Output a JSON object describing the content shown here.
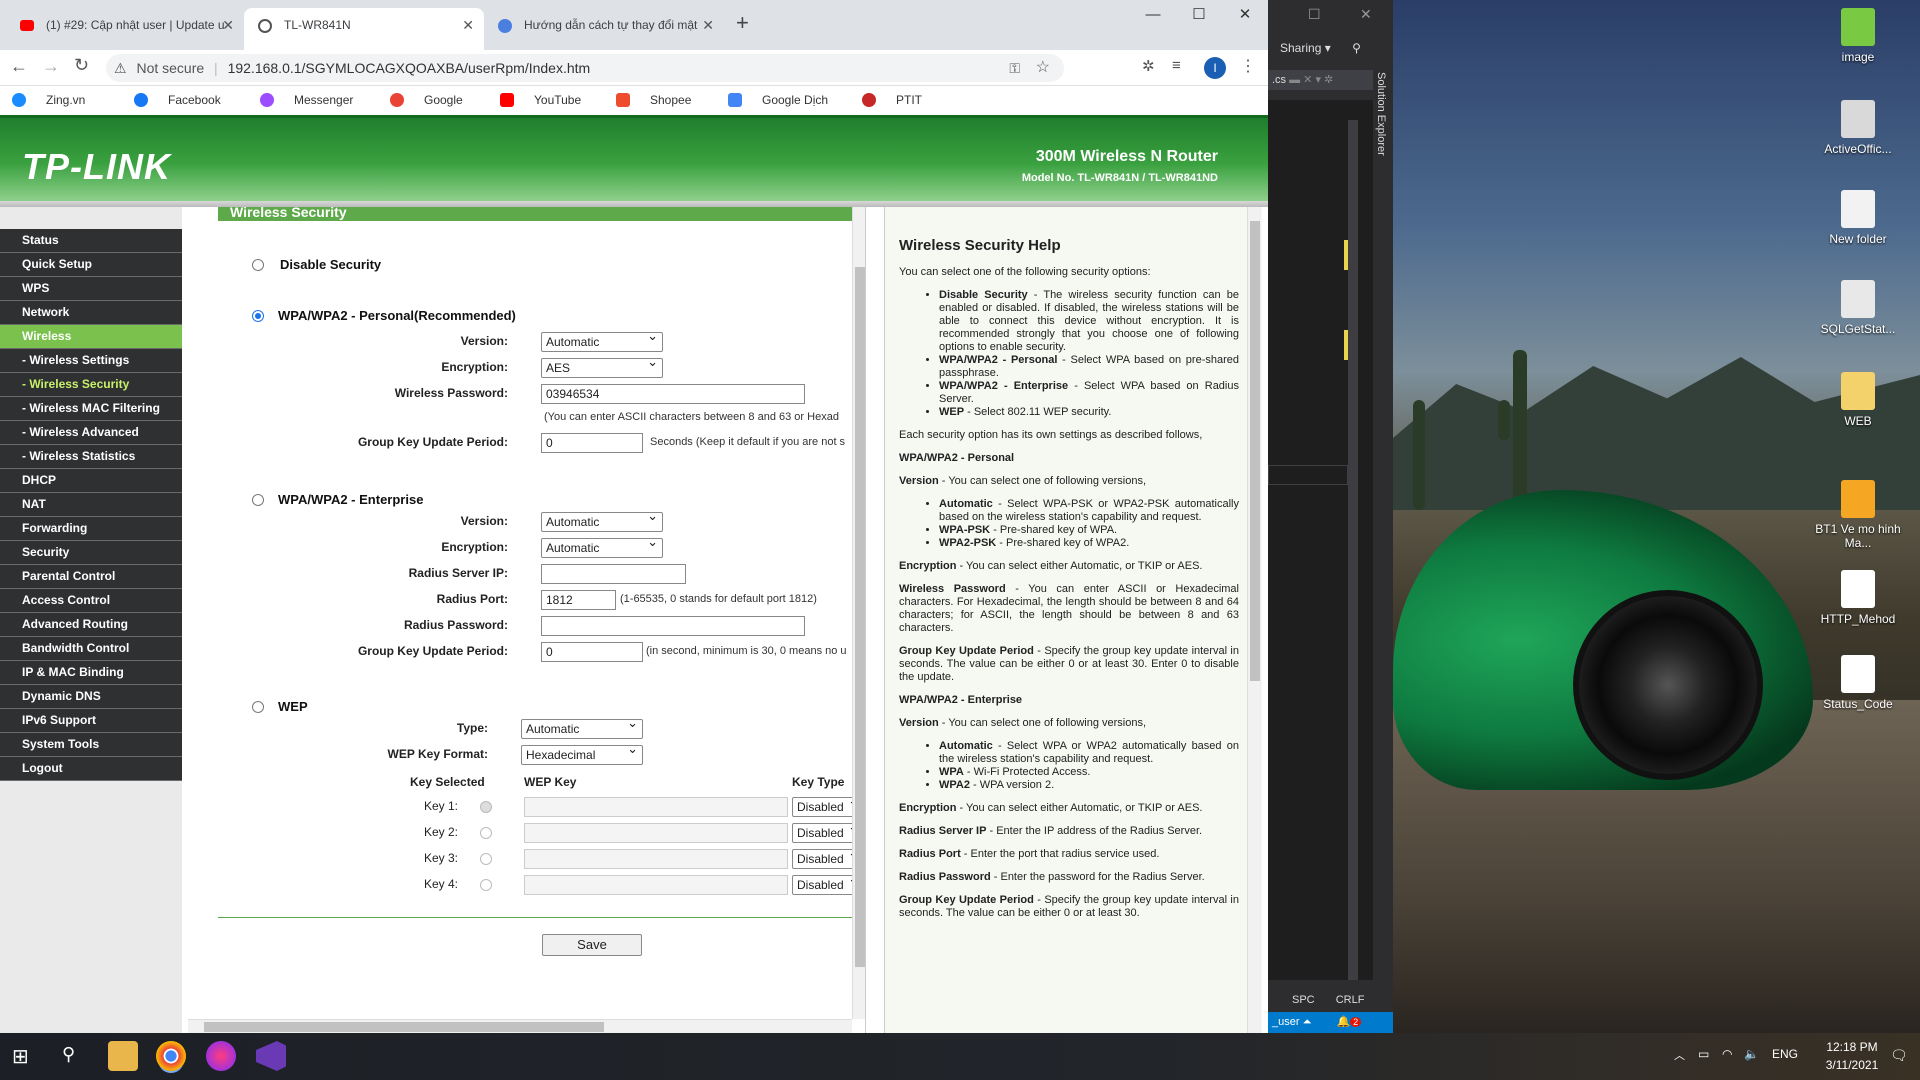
{
  "browser": {
    "tabs": [
      {
        "label": "(1) #29: Cập nhật user | Update u",
        "active": false
      },
      {
        "label": "TL-WR841N",
        "active": true
      },
      {
        "label": "Hướng dẫn cách tự thay đổi mật",
        "active": false
      }
    ],
    "new_tab": "+",
    "window_controls": {
      "minimize": "—",
      "maximize": "☐",
      "close": "✕"
    },
    "security_label": "Not secure",
    "url": "192.168.0.1/SGYMLOCAGXQOAXBA/userRpm/Index.htm",
    "profile_initial": "I",
    "bookmarks": [
      "Zing.vn",
      "Facebook",
      "Messenger",
      "Google",
      "YouTube",
      "Shopee",
      "Google Dịch",
      "PTIT"
    ]
  },
  "router": {
    "logo": "TP-LINK",
    "product": "300M Wireless N Router",
    "model": "Model No. TL-WR841N / TL-WR841ND",
    "menu": [
      {
        "label": "Status",
        "state": ""
      },
      {
        "label": "Quick Setup",
        "state": ""
      },
      {
        "label": "WPS",
        "state": ""
      },
      {
        "label": "Network",
        "state": ""
      },
      {
        "label": "Wireless",
        "state": "on"
      },
      {
        "label": "- Wireless Settings",
        "state": "sub"
      },
      {
        "label": "- Wireless Security",
        "state": "subon"
      },
      {
        "label": "- Wireless MAC Filtering",
        "state": "sub"
      },
      {
        "label": "- Wireless Advanced",
        "state": "sub"
      },
      {
        "label": "- Wireless Statistics",
        "state": "sub"
      },
      {
        "label": "DHCP",
        "state": ""
      },
      {
        "label": "NAT",
        "state": ""
      },
      {
        "label": "Forwarding",
        "state": ""
      },
      {
        "label": "Security",
        "state": ""
      },
      {
        "label": "Parental Control",
        "state": ""
      },
      {
        "label": "Access Control",
        "state": ""
      },
      {
        "label": "Advanced Routing",
        "state": ""
      },
      {
        "label": "Bandwidth Control",
        "state": ""
      },
      {
        "label": "IP & MAC Binding",
        "state": ""
      },
      {
        "label": "Dynamic DNS",
        "state": ""
      },
      {
        "label": "IPv6 Support",
        "state": ""
      },
      {
        "label": "System Tools",
        "state": ""
      },
      {
        "label": "Logout",
        "state": ""
      }
    ],
    "section_header": "Wireless Security",
    "disable": {
      "label": "Disable Security"
    },
    "personal": {
      "label": "WPA/WPA2 - Personal(Recommended)",
      "version_label": "Version:",
      "version": "Automatic",
      "encryption_label": "Encryption:",
      "encryption": "AES",
      "password_label": "Wireless Password:",
      "password": "03946534",
      "password_note": "(You can enter ASCII characters between 8 and 63 or Hexad",
      "gkup_label": "Group Key Update Period:",
      "gkup": "0",
      "gkup_note": "Seconds (Keep it default if you are not s"
    },
    "enterprise": {
      "label": "WPA/WPA2 - Enterprise",
      "version_label": "Version:",
      "version": "Automatic",
      "encryption_label": "Encryption:",
      "encryption": "Automatic",
      "server_label": "Radius Server IP:",
      "server": "",
      "port_label": "Radius Port:",
      "port": "1812",
      "port_note": "(1-65535, 0 stands for default port 1812)",
      "rpass_label": "Radius Password:",
      "rpass": "",
      "gkup_label": "Group Key Update Period:",
      "gkup": "0",
      "gkup_note": "(in second, minimum is 30, 0 means no u"
    },
    "wep": {
      "label": "WEP",
      "type_label": "Type:",
      "type": "Automatic",
      "format_label": "WEP Key Format:",
      "format": "Hexadecimal",
      "col_selected": "Key Selected",
      "col_key": "WEP Key",
      "col_type": "Key Type",
      "keys": [
        {
          "label": "Key 1:",
          "type": "Disabled"
        },
        {
          "label": "Key 2:",
          "type": "Disabled"
        },
        {
          "label": "Key 3:",
          "type": "Disabled"
        },
        {
          "label": "Key 4:",
          "type": "Disabled"
        }
      ]
    },
    "save": "Save"
  },
  "help": {
    "title": "Wireless Security Help",
    "intro": "You can select one of the following security options:",
    "opts": [
      {
        "k": "Disable Security",
        "t": " - The wireless security function can be enabled or disabled. If disabled, the wireless stations will be able to connect this device without encryption. It is recommended strongly that you choose one of following options to enable security."
      },
      {
        "k": "WPA/WPA2 - Personal",
        "t": " - Select WPA based on pre-shared passphrase."
      },
      {
        "k": "WPA/WPA2 - Enterprise",
        "t": " - Select WPA based on Radius Server."
      },
      {
        "k": "WEP",
        "t": " - Select 802.11 WEP security."
      }
    ],
    "each": "Each security option has its own settings as described follows,",
    "h_personal": "WPA/WPA2 - Personal",
    "version_k": "Version",
    "version_t": " - You can select one of following versions,",
    "pv": [
      {
        "k": "Automatic",
        "t": " - Select WPA-PSK or WPA2-PSK automatically based on the wireless station's capability and request."
      },
      {
        "k": "WPA-PSK",
        "t": " - Pre-shared key of WPA."
      },
      {
        "k": "WPA2-PSK",
        "t": " - Pre-shared key of WPA2."
      }
    ],
    "enc_k": "Encryption",
    "enc_t": " - You can select either Automatic, or TKIP or AES.",
    "pw_k": "Wireless Password",
    "pw_t": " - You can enter ASCII or Hexadecimal characters. For Hexadecimal, the length should be between 8 and 64 characters; for ASCII, the length should be between 8 and 63 characters.",
    "gk_k": "Group Key Update Period",
    "gk_t": " - Specify the group key update interval in seconds. The value can be either 0 or at least 30. Enter 0 to disable the update.",
    "h_enterprise": "WPA/WPA2 - Enterprise",
    "ev": [
      {
        "k": "Automatic",
        "t": " - Select WPA or WPA2 automatically based on the wireless station's capability and request."
      },
      {
        "k": "WPA",
        "t": " - Wi-Fi Protected Access."
      },
      {
        "k": "WPA2",
        "t": " - WPA version 2."
      }
    ],
    "rip_k": "Radius Server IP",
    "rip_t": " - Enter the IP address of the Radius Server.",
    "rport_k": "Radius Port",
    "rport_t": " - Enter the port that radius service used.",
    "rpw_k": "Radius Password",
    "rpw_t": " - Enter the password for the Radius Server.",
    "gk2_t": " - Specify the group key update interval in seconds. The value can be either 0 or at least 30."
  },
  "vs": {
    "sharing": "Sharing",
    "tab": ".cs",
    "solution_explorer": "Solution Explorer",
    "spc": "SPC",
    "crlf": "CRLF",
    "user": "_user",
    "notif": "2"
  },
  "desktop_icons": [
    "image",
    "ActiveOffic...",
    "New folder",
    "SQLGetStat...",
    "WEB",
    "BT1 Ve mo hinh Ma...",
    "HTTP_Mehod",
    "Status_Code"
  ],
  "taskbar": {
    "lang": "ENG",
    "time": "12:18 PM",
    "date": "3/11/2021"
  }
}
